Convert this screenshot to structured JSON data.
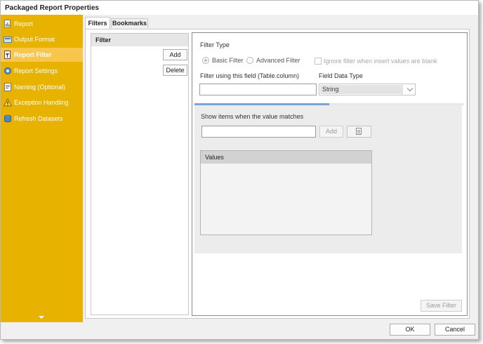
{
  "window": {
    "title": "Packaged Report Properties"
  },
  "sidebar": {
    "items": [
      {
        "label": "Report",
        "icon": "report-icon"
      },
      {
        "label": "Output Format",
        "icon": "output-format-icon"
      },
      {
        "label": "Report Filter",
        "icon": "report-filter-icon",
        "active": true
      },
      {
        "label": "Report Settings",
        "icon": "report-settings-icon"
      },
      {
        "label": "Naming (Optional)",
        "icon": "naming-icon"
      },
      {
        "label": "Exception Handling",
        "icon": "warning-icon"
      },
      {
        "label": "Refresh Datasets",
        "icon": "refresh-datasets-icon"
      }
    ],
    "accent_color": "#e8b200"
  },
  "tabs": [
    {
      "label": "Filters",
      "active": true
    },
    {
      "label": "Bookmarks",
      "active": false
    }
  ],
  "filter_list": {
    "header": "Filter",
    "add_label": "Add",
    "delete_label": "Delete"
  },
  "filter_editor": {
    "filter_type_label": "Filter Type",
    "basic_filter_label": "Basic Filter",
    "advanced_filter_label": "Advanced Filter",
    "selected_type": "Basic Filter",
    "ignore_filter_label": "Ignore filter when insert values are blank",
    "field_label": "Filter using this field (Table.column)",
    "field_value": "",
    "data_type_label": "Field Data Type",
    "data_type_value": "String",
    "progress_fraction": 0.5,
    "match_label": "Show items when the value matches",
    "match_value": "",
    "match_add_label": "Add",
    "values_header": "Values",
    "save_filter_label": "Save Filter"
  },
  "footer": {
    "ok_label": "OK",
    "cancel_label": "Cancel"
  }
}
